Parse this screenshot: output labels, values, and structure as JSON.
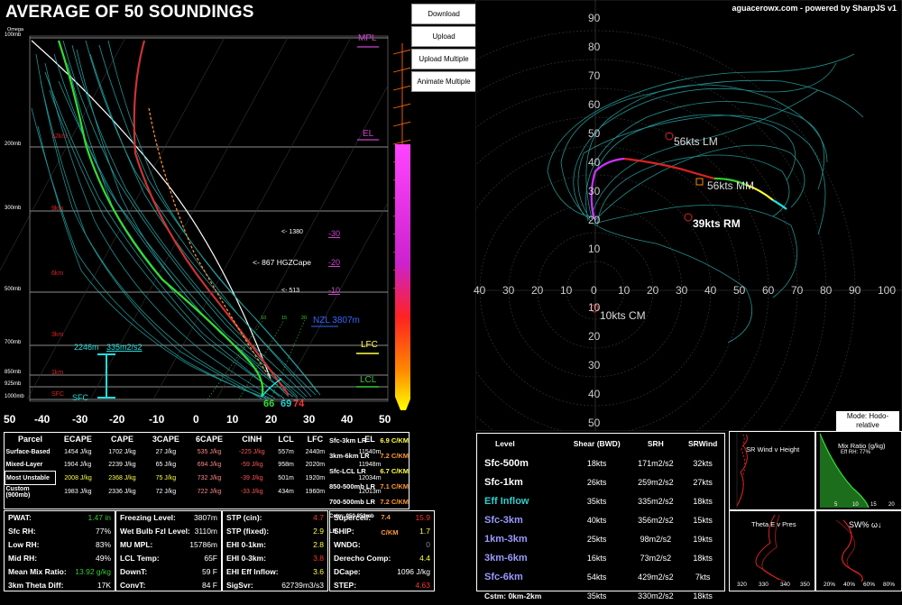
{
  "title": "AVERAGE OF 50 SOUNDINGS",
  "credit": "aguacerowx.com - powered by SharpJS v1",
  "buttons": {
    "download": "Download",
    "upload": "Upload",
    "upload_multiple": "Upload Multiple",
    "animate_multiple": "Animate Multiple"
  },
  "mode_button": "Mode: Hodo-relative",
  "skewt": {
    "omega_label": "Omega",
    "pressure_labels": [
      "100mb",
      "200mb",
      "300mb",
      "500mb",
      "700mb",
      "850mb",
      "925mb",
      "1000mb"
    ],
    "height_labels": [
      "12km",
      "9km",
      "6km",
      "3km",
      "1km",
      "SFC"
    ],
    "x_ticks": [
      "50",
      "-40",
      "-30",
      "-20",
      "-10",
      "0",
      "10",
      "20",
      "30",
      "40",
      "50"
    ],
    "markers": {
      "mpl": "MPL",
      "el": "EL",
      "lfc": "LFC",
      "lcl": "LCL",
      "nzl": "NZL 3807m"
    },
    "temp_levels": [
      "-30",
      "-20",
      "-10"
    ],
    "hgz": {
      "top": "<- 1380",
      "mid": "<- 867 HGZCape",
      "bot": "<- 513"
    },
    "wb_ticks": [
      "10",
      "15",
      "20"
    ],
    "eff_inflow": "2246m",
    "eff_srh": "335m2/s2",
    "sfc_label": "SFC",
    "sfc_td": "66",
    "sfc_tw": "69",
    "sfc_t": "74"
  },
  "hodo": {
    "rings": [
      "10",
      "20",
      "30",
      "40",
      "50",
      "60",
      "70",
      "80",
      "90"
    ],
    "x_ticks": [
      "40",
      "30",
      "20",
      "10",
      "0",
      "10",
      "20",
      "30",
      "40",
      "50",
      "60",
      "70",
      "80",
      "90",
      "100"
    ],
    "y_pos": [
      "90",
      "80",
      "70",
      "60",
      "50",
      "40",
      "30",
      "20",
      "10"
    ],
    "y_neg": [
      "10",
      "20",
      "30",
      "40",
      "50"
    ],
    "lm": "56kts LM",
    "mm": "56kts MM",
    "rm": "39kts RM",
    "cm": "10kts CM"
  },
  "parcel_table": {
    "headers": [
      "Parcel",
      "ECAPE",
      "CAPE",
      "3CAPE",
      "6CAPE",
      "CINH",
      "LCL",
      "LFC",
      "EL"
    ],
    "rows": [
      {
        "name": "Surface-Based",
        "ecape": "1454 J/kg",
        "cape": "1702 J/kg",
        "c3": "27 J/kg",
        "c6": "535 J/kg",
        "cinh": "-225 J/kg",
        "lcl": "557m",
        "lfc": "2440m",
        "el": "11540m"
      },
      {
        "name": "Mixed-Layer",
        "ecape": "1904 J/kg",
        "cape": "2239 J/kg",
        "c3": "65 J/kg",
        "c6": "694 J/kg",
        "cinh": "-59 J/kg",
        "lcl": "958m",
        "lfc": "2020m",
        "el": "11948m"
      },
      {
        "name": "Most Unstable",
        "ecape": "2008 J/kg",
        "cape": "2368 J/kg",
        "c3": "75 J/kg",
        "c6": "732 J/kg",
        "cinh": "-39 J/kg",
        "lcl": "501m",
        "lfc": "1920m",
        "el": "12034m"
      },
      {
        "name": "Custom (900mb)",
        "ecape": "1983 J/kg",
        "cape": "2336 J/kg",
        "c3": "72 J/kg",
        "c6": "722 J/kg",
        "cinh": "-33 J/kg",
        "lcl": "434m",
        "lfc": "1960m",
        "el": "12013m"
      }
    ]
  },
  "lapse_rates": [
    {
      "label": "Sfc-3km LR",
      "value": "6.9 C/KM",
      "color": "#ffff44"
    },
    {
      "label": "3km-6km LR",
      "value": "7.2 C/KM",
      "color": "#ff9933"
    },
    {
      "label": "Sfc-LCL LR",
      "value": "6.7 C/KM",
      "color": "#ffff44"
    },
    {
      "label": "850-500mb LR",
      "value": "7.1 C/KM",
      "color": "#ff9933"
    },
    {
      "label": "700-500mb LR",
      "value": "7.2 C/KM",
      "color": "#ff9933"
    },
    {
      "label": "Cstm: 950-850mb LR",
      "value": "7.4 C/KM",
      "color": "#ff9933"
    }
  ],
  "indices1": [
    {
      "label": "PWAT:",
      "value": "1.47 in",
      "color": "#33cc33"
    },
    {
      "label": "Sfc RH:",
      "value": "77%",
      "color": "#ffffff"
    },
    {
      "label": "Low RH:",
      "value": "83%",
      "color": "#ffffff"
    },
    {
      "label": "Mid RH:",
      "value": "49%",
      "color": "#ffffff"
    },
    {
      "label": "Mean Mix Ratio:",
      "value": "13.92 g/kg",
      "color": "#33cc33"
    },
    {
      "label": "3km Theta Diff:",
      "value": "17K",
      "color": "#ffffff"
    }
  ],
  "indices2": [
    {
      "label": "Freezing Level:",
      "value": "3807m",
      "color": "#ffffff"
    },
    {
      "label": "Wet Bulb Fzl Level:",
      "value": "3110m",
      "color": "#ffffff"
    },
    {
      "label": "MU MPL:",
      "value": "15786m",
      "color": "#ffffff"
    },
    {
      "label": "LCL Temp:",
      "value": "65F",
      "color": "#ffffff"
    },
    {
      "label": "DownT:",
      "value": "59 F",
      "color": "#ffffff"
    },
    {
      "label": "ConvT:",
      "value": "84 F",
      "color": "#ffffff"
    }
  ],
  "indices3": [
    {
      "label": "STP (cin):",
      "value": "4.7",
      "color": "#ff3333"
    },
    {
      "label": "STP (fixed):",
      "value": "2.9",
      "color": "#ffff44"
    },
    {
      "label": "EHI 0-1km:",
      "value": "2.8",
      "color": "#ffff44"
    },
    {
      "label": "EHI 0-3km:",
      "value": "3.8",
      "color": "#ff3333"
    },
    {
      "label": "EHI Eff Inflow:",
      "value": "3.6",
      "color": "#ffff44"
    },
    {
      "label": "SigSvr:",
      "value": "62739m3/s3",
      "color": "#ffffff"
    }
  ],
  "indices4": [
    {
      "label": "Supercell:",
      "value": "15.9",
      "color": "#ff3333"
    },
    {
      "label": "SHIP:",
      "value": "1.7",
      "color": "#ffff44"
    },
    {
      "label": "WNDG:",
      "value": "0",
      "color": "#888888"
    },
    {
      "label": "Derecho Comp:",
      "value": "4.4",
      "color": "#ffff44"
    },
    {
      "label": "DCape:",
      "value": "1096 J/kg",
      "color": "#ffffff"
    },
    {
      "label": "STEP:",
      "value": "4.63",
      "color": "#ff3333"
    }
  ],
  "shear_table": {
    "headers": [
      "Level",
      "Shear (BWD)",
      "SRH",
      "SRWind"
    ],
    "rows": [
      {
        "level": "Sfc-500m",
        "bwd": "18kts",
        "srh": "171m2/s2",
        "srw": "32kts",
        "color": "#ffffff"
      },
      {
        "level": "Sfc-1km",
        "bwd": "26kts",
        "srh": "259m2/s2",
        "srw": "27kts",
        "color": "#ffffff"
      },
      {
        "level": "Eff Inflow",
        "bwd": "35kts",
        "srh": "335m2/s2",
        "srw": "18kts",
        "color": "#33cccc"
      },
      {
        "level": "Sfc-3km",
        "bwd": "40kts",
        "srh": "356m2/s2",
        "srw": "15kts",
        "color": "#9999ff"
      },
      {
        "level": "1km-3km",
        "bwd": "25kts",
        "srh": "98m2/s2",
        "srw": "19kts",
        "color": "#9999ff"
      },
      {
        "level": "3km-6km",
        "bwd": "16kts",
        "srh": "73m2/s2",
        "srw": "18kts",
        "color": "#9999ff"
      },
      {
        "level": "Sfc-6km",
        "bwd": "54kts",
        "srh": "429m2/s2",
        "srw": "7kts",
        "color": "#9999ff"
      },
      {
        "level": "Cstm: 0km-2km",
        "bwd": "35kts",
        "srh": "330m2/s2",
        "srw": "18kts",
        "color": "#ffffff"
      }
    ]
  },
  "mini": {
    "srwind_title": "SR Wind  v  Height",
    "mix_title": "Mix Ratio (g/kg)",
    "mix_sub": "Eff RH: 77%",
    "theta_title": "Theta E  v  Pres",
    "theta_ticks": [
      "320",
      "330",
      "340",
      "350"
    ],
    "sw_title": "SW% ω↓",
    "sw_ticks": [
      "20%",
      "40%",
      "60%",
      "80%"
    ],
    "mix_ticks": [
      "5",
      "10",
      "15",
      "20"
    ]
  }
}
